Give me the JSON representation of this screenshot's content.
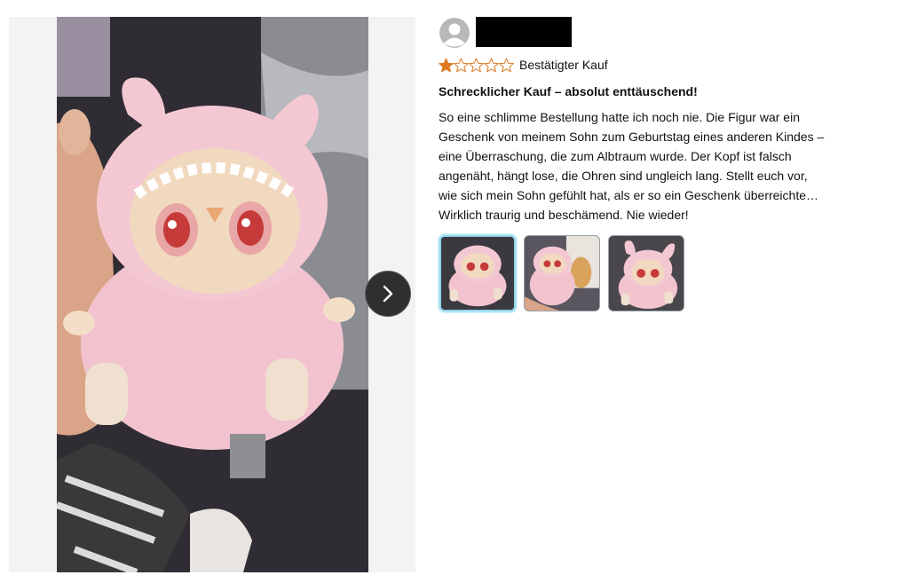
{
  "review": {
    "verified_label": "Bestätigter Kauf",
    "rating": 1,
    "rating_max": 5,
    "title": "Schrecklicher Kauf – absolut enttäuschend!",
    "body_lines": [
      "So eine schlimme Bestellung hatte ich noch nie. Die Figur war ein",
      "Geschenk von meinem Sohn zum Geburtstag eines anderen Kindes –",
      "eine Überraschung, die zum Albtraum wurde. Der Kopf ist falsch",
      "angenäht, hängt lose, die Ohren sind ungleich lang. Stellt euch vor,",
      "wie sich mein Sohn gefühlt hat, als er so ein Geschenk überreichte…",
      "Wirklich traurig und beschämend. Nie wieder!"
    ]
  },
  "media": {
    "thumbnail_count": 3,
    "selected_index": 0
  },
  "colors": {
    "star_fill": "#de7921",
    "star_outline": "#de7921",
    "toy_pink": "#f4c8d2",
    "selected_thumb_border": "#8fd3e8"
  },
  "icons": {
    "next": "chevron-right-icon",
    "avatar": "user-avatar-icon"
  }
}
